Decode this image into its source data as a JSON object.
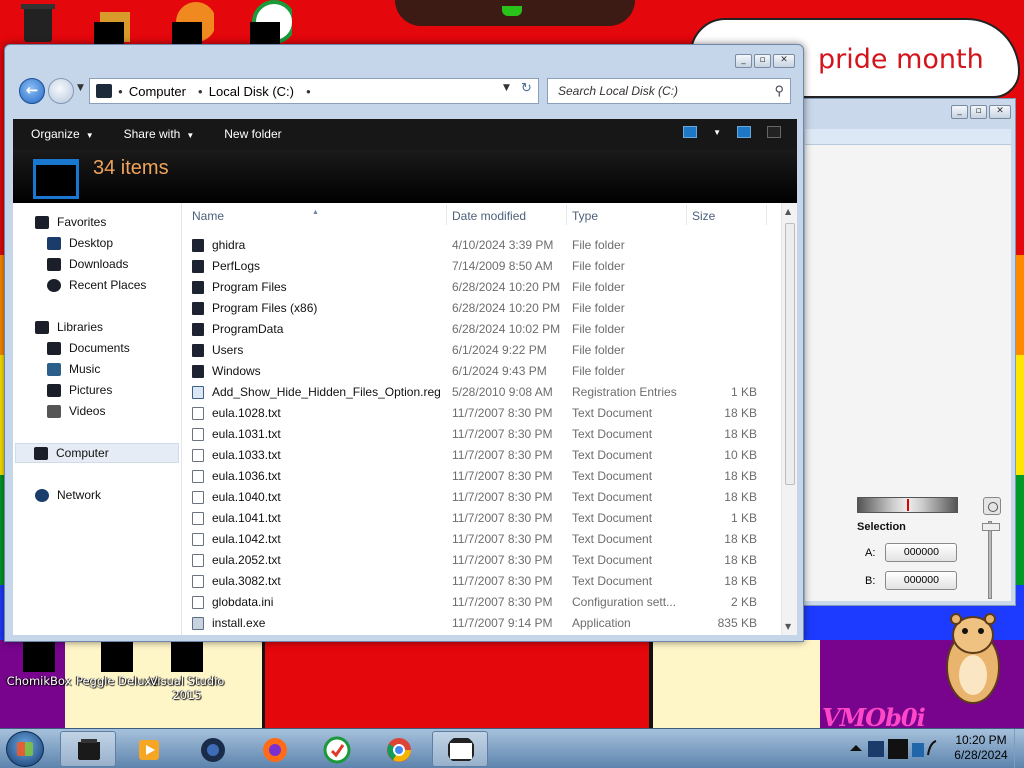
{
  "wallpaper": {
    "banner_text": "pride month",
    "watermark": "VMOb0i"
  },
  "desktop_icons": [
    {
      "label": "ChomikBox"
    },
    {
      "label": "Peggle Deluxe"
    },
    {
      "label": "Visual Studio 2015"
    }
  ],
  "explorer": {
    "address": {
      "segments": [
        "Computer",
        "Local Disk (C:)"
      ]
    },
    "search": {
      "placeholder": "Search Local Disk (C:)"
    },
    "toolbar": {
      "organize": "Organize",
      "share_with": "Share with",
      "new_folder": "New folder"
    },
    "item_count": "34 items",
    "nav": {
      "favorites": "Favorites",
      "favorites_items": [
        "Desktop",
        "Downloads",
        "Recent Places"
      ],
      "libraries": "Libraries",
      "libraries_items": [
        "Documents",
        "Music",
        "Pictures",
        "Videos"
      ],
      "computer": "Computer",
      "network": "Network"
    },
    "columns": {
      "name": "Name",
      "date_modified": "Date modified",
      "type": "Type",
      "size": "Size"
    },
    "files": [
      {
        "name": "ghidra",
        "date": "4/10/2024 3:39 PM",
        "type": "File folder",
        "size": "",
        "icon": "folder-icon"
      },
      {
        "name": "PerfLogs",
        "date": "7/14/2009 8:50 AM",
        "type": "File folder",
        "size": "",
        "icon": "folder-icon"
      },
      {
        "name": "Program Files",
        "date": "6/28/2024 10:20 PM",
        "type": "File folder",
        "size": "",
        "icon": "folder-icon"
      },
      {
        "name": "Program Files (x86)",
        "date": "6/28/2024 10:20 PM",
        "type": "File folder",
        "size": "",
        "icon": "folder-icon"
      },
      {
        "name": "ProgramData",
        "date": "6/28/2024 10:02 PM",
        "type": "File folder",
        "size": "",
        "icon": "folder-icon"
      },
      {
        "name": "Users",
        "date": "6/1/2024 9:22 PM",
        "type": "File folder",
        "size": "",
        "icon": "folder-icon"
      },
      {
        "name": "Windows",
        "date": "6/1/2024 9:43 PM",
        "type": "File folder",
        "size": "",
        "icon": "folder-icon"
      },
      {
        "name": "Add_Show_Hide_Hidden_Files_Option.reg",
        "date": "5/28/2010 9:08 AM",
        "type": "Registration Entries",
        "size": "1 KB",
        "icon": "registry-file-icon"
      },
      {
        "name": "eula.1028.txt",
        "date": "11/7/2007 8:30 PM",
        "type": "Text Document",
        "size": "18 KB",
        "icon": "text-file-icon"
      },
      {
        "name": "eula.1031.txt",
        "date": "11/7/2007 8:30 PM",
        "type": "Text Document",
        "size": "18 KB",
        "icon": "text-file-icon"
      },
      {
        "name": "eula.1033.txt",
        "date": "11/7/2007 8:30 PM",
        "type": "Text Document",
        "size": "10 KB",
        "icon": "text-file-icon"
      },
      {
        "name": "eula.1036.txt",
        "date": "11/7/2007 8:30 PM",
        "type": "Text Document",
        "size": "18 KB",
        "icon": "text-file-icon"
      },
      {
        "name": "eula.1040.txt",
        "date": "11/7/2007 8:30 PM",
        "type": "Text Document",
        "size": "18 KB",
        "icon": "text-file-icon"
      },
      {
        "name": "eula.1041.txt",
        "date": "11/7/2007 8:30 PM",
        "type": "Text Document",
        "size": "1 KB",
        "icon": "text-file-icon"
      },
      {
        "name": "eula.1042.txt",
        "date": "11/7/2007 8:30 PM",
        "type": "Text Document",
        "size": "18 KB",
        "icon": "text-file-icon"
      },
      {
        "name": "eula.2052.txt",
        "date": "11/7/2007 8:30 PM",
        "type": "Text Document",
        "size": "18 KB",
        "icon": "text-file-icon"
      },
      {
        "name": "eula.3082.txt",
        "date": "11/7/2007 8:30 PM",
        "type": "Text Document",
        "size": "18 KB",
        "icon": "text-file-icon"
      },
      {
        "name": "globdata.ini",
        "date": "11/7/2007 8:30 PM",
        "type": "Configuration sett...",
        "size": "2 KB",
        "icon": "config-file-icon"
      },
      {
        "name": "install.exe",
        "date": "11/7/2007 9:14 PM",
        "type": "Application",
        "size": "835 KB",
        "icon": "application-icon"
      }
    ]
  },
  "background_window": {
    "selection_label": "Selection",
    "a_label": "A:",
    "a_value": "000000",
    "b_label": "B:",
    "b_value": "000000"
  },
  "taskbar": {
    "time": "10:20 PM",
    "date": "6/28/2024"
  }
}
